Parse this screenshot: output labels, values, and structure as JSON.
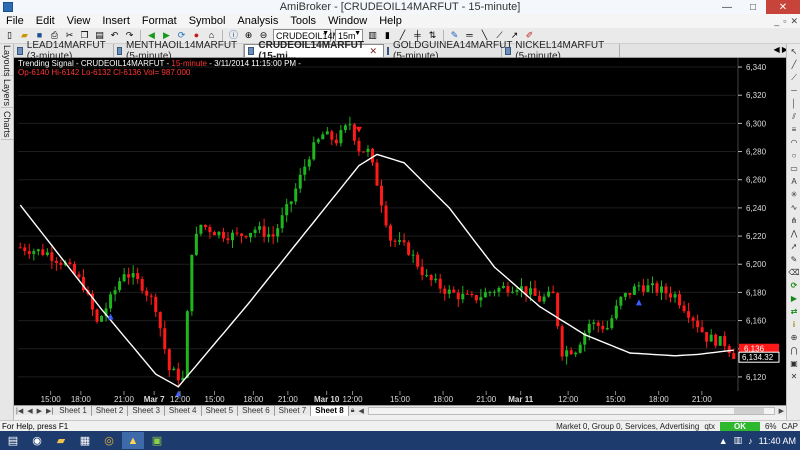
{
  "window": {
    "title": "AmiBroker - [CRUDEOIL14MARFUT - 15-minute]",
    "minimize": "—",
    "maximize": "□",
    "close": "✕"
  },
  "menu": [
    "File",
    "Edit",
    "View",
    "Insert",
    "Format",
    "Symbol",
    "Analysis",
    "Tools",
    "Window",
    "Help"
  ],
  "toolbar": {
    "symbol_value": "CRUDEOIL14M",
    "interval_value": "15m"
  },
  "tabs": [
    {
      "label": "LEAD14MARFUT (3-minute)",
      "active": false
    },
    {
      "label": "MENTHAOIL14MARFUT (5-minute)",
      "active": false
    },
    {
      "label": "CRUDEOIL14MARFUT (15-mi...",
      "active": true
    },
    {
      "label": "GOLDGUINEA14MARFUT (5-minute)",
      "active": false
    },
    {
      "label": "NICKEL14MARFUT (5-minute)",
      "active": false
    }
  ],
  "side_tabs": [
    "Layouts",
    "Layers",
    "Charts"
  ],
  "chart_header": {
    "title": "Trending Signal - CRUDEOIL14MARFUT - ",
    "timeframe": "15-minute",
    "datetime": " - 3/11/2014 11:15:00 PM - ",
    "ohlc": "Op-6140 Hi-6142 Lo-6132 Cl-6136 Vol= 987.000"
  },
  "colors": {
    "background": "#000000",
    "up": "#1fb51f",
    "down": "#ff1a1a",
    "line": "#ffffff",
    "label": "#ff1a1a"
  },
  "chart_data": {
    "type": "candlestick",
    "ylim": [
      6110,
      6345
    ],
    "y_ticks": [
      6120,
      6140,
      6160,
      6180,
      6200,
      6220,
      6240,
      6260,
      6280,
      6300,
      6320,
      6340
    ],
    "y_tick_labels": [
      "6,120",
      "6,140",
      "6,160",
      "6,180",
      "6,200",
      "6,220",
      "6,240",
      "6,260",
      "6,280",
      "6,300",
      "6,320",
      "6,340"
    ],
    "x_ticks": [
      {
        "label": "15:00",
        "bold": false
      },
      {
        "label": "18:00",
        "bold": false
      },
      {
        "label": "21:00",
        "bold": false
      },
      {
        "label": "Mar 7",
        "bold": true
      },
      {
        "label": "12:00",
        "bold": false
      },
      {
        "label": "15:00",
        "bold": false
      },
      {
        "label": "18:00",
        "bold": false
      },
      {
        "label": "21:00",
        "bold": false
      },
      {
        "label": "Mar 10",
        "bold": true
      },
      {
        "label": "12:00",
        "bold": false
      },
      {
        "label": "15:00",
        "bold": false
      },
      {
        "label": "18:00",
        "bold": false
      },
      {
        "label": "21:00",
        "bold": false
      },
      {
        "label": "Mar 11",
        "bold": true
      },
      {
        "label": "12:00",
        "bold": false
      },
      {
        "label": "15:00",
        "bold": false
      },
      {
        "label": "18:00",
        "bold": false
      },
      {
        "label": "21:00",
        "bold": false
      }
    ],
    "last_price_label": "6,134.32",
    "close_label": "6,136",
    "price_anchors": [
      [
        0,
        6212
      ],
      [
        6,
        6208
      ],
      [
        10,
        6200
      ],
      [
        14,
        6185
      ],
      [
        17,
        6158
      ],
      [
        20,
        6175
      ],
      [
        23,
        6195
      ],
      [
        27,
        6185
      ],
      [
        30,
        6170
      ],
      [
        33,
        6125
      ],
      [
        36,
        6118
      ],
      [
        38,
        6210
      ],
      [
        40,
        6228
      ],
      [
        44,
        6222
      ],
      [
        48,
        6220
      ],
      [
        52,
        6225
      ],
      [
        56,
        6220
      ],
      [
        60,
        6245
      ],
      [
        64,
        6278
      ],
      [
        67,
        6292
      ],
      [
        70,
        6288
      ],
      [
        73,
        6300
      ],
      [
        75,
        6282
      ],
      [
        77,
        6280
      ],
      [
        79,
        6258
      ],
      [
        82,
        6218
      ],
      [
        86,
        6210
      ],
      [
        90,
        6190
      ],
      [
        95,
        6180
      ],
      [
        100,
        6175
      ],
      [
        105,
        6182
      ],
      [
        110,
        6185
      ],
      [
        115,
        6175
      ],
      [
        118,
        6178
      ],
      [
        120,
        6138
      ],
      [
        123,
        6140
      ],
      [
        126,
        6158
      ],
      [
        130,
        6155
      ],
      [
        133,
        6175
      ],
      [
        137,
        6185
      ],
      [
        141,
        6182
      ],
      [
        145,
        6178
      ],
      [
        149,
        6162
      ],
      [
        152,
        6148
      ],
      [
        156,
        6144
      ],
      [
        158,
        6136
      ]
    ],
    "line_anchors": [
      [
        0,
        6242
      ],
      [
        18,
        6168
      ],
      [
        30,
        6122
      ],
      [
        35,
        6113
      ],
      [
        50,
        6170
      ],
      [
        65,
        6230
      ],
      [
        75,
        6270
      ],
      [
        79,
        6278
      ],
      [
        85,
        6272
      ],
      [
        95,
        6240
      ],
      [
        105,
        6198
      ],
      [
        115,
        6170
      ],
      [
        125,
        6150
      ],
      [
        135,
        6137
      ],
      [
        145,
        6135
      ],
      [
        150,
        6136
      ],
      [
        158,
        6139
      ]
    ],
    "signals": [
      {
        "bar": 20,
        "direction": "up"
      },
      {
        "bar": 35,
        "direction": "up"
      },
      {
        "bar": 75,
        "direction": "down"
      },
      {
        "bar": 137,
        "direction": "up"
      }
    ]
  },
  "sheets": [
    "Sheet 1",
    "Sheet 2",
    "Sheet 3",
    "Sheet 4",
    "Sheet 5",
    "Sheet 6",
    "Sheet 7",
    "Sheet 8"
  ],
  "active_sheet": "Sheet 8",
  "status": {
    "help": "For Help, press F1",
    "market": "Market 0, Group 0, Services, Advertising",
    "qtx": "qtx",
    "ok": "OK",
    "percent": "6%",
    "cap": "CAP"
  },
  "clock": "11:40 AM"
}
